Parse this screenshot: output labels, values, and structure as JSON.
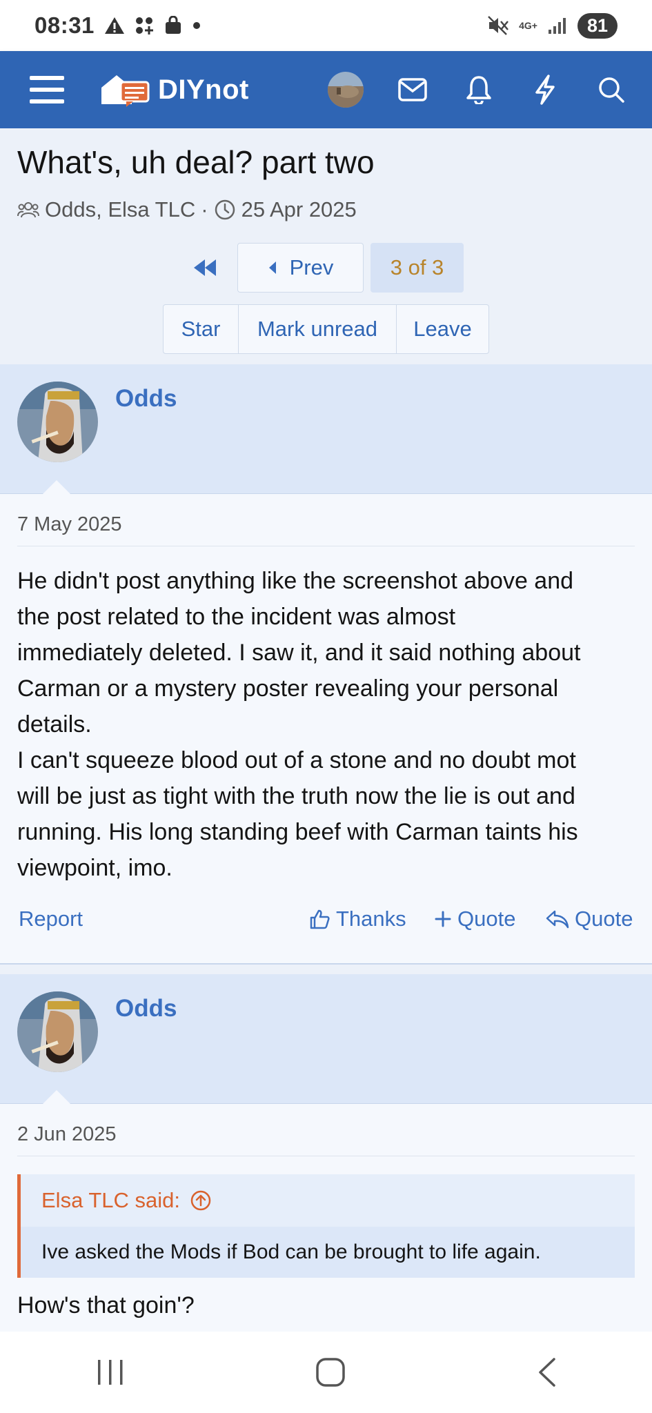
{
  "status_bar": {
    "time": "08:31",
    "network": "4G+",
    "battery": "81",
    "left_icons": [
      "warning-icon",
      "apps-icon",
      "shopping-bag-icon",
      "dot-icon"
    ],
    "right_icons": [
      "mute-icon",
      "network-icon",
      "signal-icon"
    ]
  },
  "nav": {
    "logo": "DIYnot",
    "icons": [
      "menu-icon",
      "avatar",
      "mail-icon",
      "bell-icon",
      "lightning-icon",
      "search-icon"
    ]
  },
  "thread": {
    "title": "What's, uh deal? part two",
    "participants": "Odds, Elsa TLC",
    "date": "25 Apr 2025"
  },
  "pagination": {
    "prev_label": "Prev",
    "current_label": "3 of 3"
  },
  "actions": {
    "star": "Star",
    "mark_unread": "Mark unread",
    "leave": "Leave"
  },
  "posts": [
    {
      "username": "Odds",
      "date": "7 May 2025",
      "body_lines": [
        "He didn't post anything like the screenshot above and",
        "the post related to the incident was almost",
        "immediately deleted. I saw it, and it said nothing about",
        "Carman or a mystery poster revealing your personal",
        "details.",
        "I can't squeeze blood out of a stone and no doubt mot",
        "will be just as tight with the truth now the lie is out and",
        "running. His long standing beef with Carman taints his",
        "viewpoint, imo."
      ],
      "report": "Report",
      "thanks": "Thanks",
      "multi_quote": "Quote",
      "quote": "Quote"
    },
    {
      "username": "Odds",
      "date": "2 Jun 2025",
      "quote_author": "Elsa TLC said:",
      "quote_text": "Ive asked the Mods if Bod can be brought to life again.",
      "reply": "How's that goin'?"
    }
  ],
  "colors": {
    "brand_blue": "#2f65b4",
    "link_blue": "#3a6fc0",
    "quote_orange": "#e06a3a",
    "current_page_gold": "#b8842b"
  }
}
